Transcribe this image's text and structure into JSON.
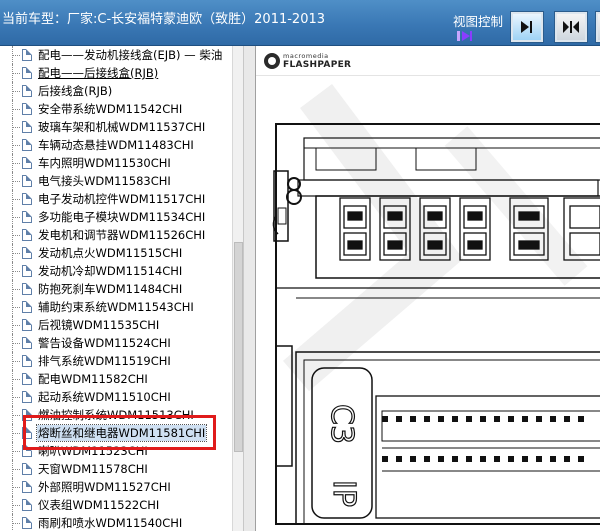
{
  "header": {
    "title": "当前车型：厂家:C-长安福特蒙迪欧（致胜）2011-2013",
    "view_control_label": "视图控制"
  },
  "tree": {
    "items": [
      {
        "label": "配电——发动机接线盒(EJB) — 柴油"
      },
      {
        "label": "配电——后接线盒(RJB)"
      },
      {
        "label": "后接线盒(RJB)"
      },
      {
        "label": "安全带系统WDM11542CHI"
      },
      {
        "label": "玻璃车架和机械WDM11537CHI"
      },
      {
        "label": "车辆动态悬挂WDM11483CHI"
      },
      {
        "label": "车内照明WDM11530CHI"
      },
      {
        "label": "电气接头WDM11583CHI"
      },
      {
        "label": "电子发动机控件WDM11517CHI"
      },
      {
        "label": "多功能电子模块WDM11534CHI"
      },
      {
        "label": "发电机和调节器WDM11526CHI"
      },
      {
        "label": "发动机点火WDM11515CHI"
      },
      {
        "label": "发动机冷却WDM11514CHI"
      },
      {
        "label": "防抱死刹车WDM11484CHI"
      },
      {
        "label": "辅助约束系统WDM11543CHI"
      },
      {
        "label": "后视镜WDM11535CHI"
      },
      {
        "label": "警告设备WDM11524CHI"
      },
      {
        "label": "排气系统WDM11519CHI"
      },
      {
        "label": "配电WDM11582CHI"
      },
      {
        "label": "起动系统WDM11510CHI"
      },
      {
        "label": "燃油控制系统WDM11513CHI"
      },
      {
        "label": "熔断丝和继电器WDM11581CHI"
      },
      {
        "label": "喇叭WDM11523CHI"
      },
      {
        "label": "天窗WDM11578CHI"
      },
      {
        "label": "外部照明WDM11527CHI"
      },
      {
        "label": "仪表组WDM11522CHI"
      },
      {
        "label": "雨刷和喷水WDM11540CHI"
      }
    ],
    "selected_index": 21
  },
  "viewer": {
    "brand_line1": "macromedia",
    "brand_line2": "FLASHPAPER",
    "diagram_labels": [
      "C3",
      "IP"
    ]
  },
  "colors": {
    "header_bg": "#3a78b5",
    "highlight": "#e01b1b",
    "selection_bg": "#cfe0f2"
  }
}
